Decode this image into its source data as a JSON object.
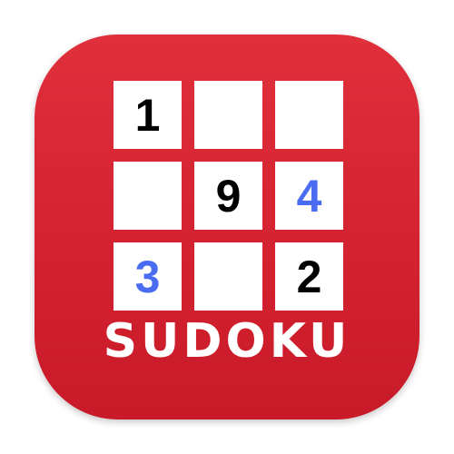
{
  "app": {
    "title": "SUDOKU",
    "background_color": "#d42230"
  },
  "grid": {
    "rows": 3,
    "cols": 3,
    "cells": [
      {
        "value": "1",
        "color": "black"
      },
      {
        "value": "",
        "color": "black"
      },
      {
        "value": "",
        "color": "black"
      },
      {
        "value": "",
        "color": "black"
      },
      {
        "value": "9",
        "color": "black"
      },
      {
        "value": "4",
        "color": "blue"
      },
      {
        "value": "3",
        "color": "blue"
      },
      {
        "value": "",
        "color": "black"
      },
      {
        "value": "2",
        "color": "black"
      }
    ],
    "digit_colors": {
      "black": "#000000",
      "blue": "#4a6cf0"
    }
  }
}
